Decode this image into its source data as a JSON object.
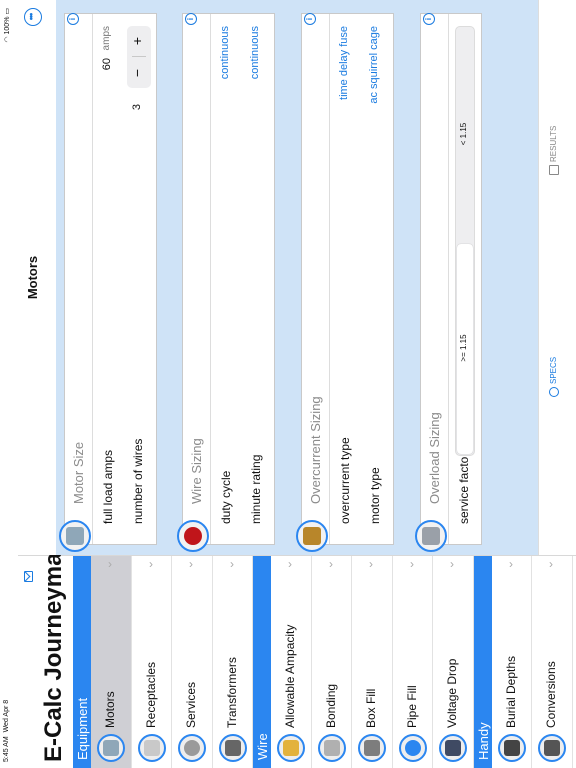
{
  "status": {
    "time": "5:45 AM",
    "date": "Wed Apr 8",
    "battery": "100%"
  },
  "app": {
    "title": "E-Calc Journeyman"
  },
  "sidebar": {
    "sections": [
      {
        "header": "Equipment",
        "items": [
          {
            "label": "Motors",
            "icon": "motor-icon",
            "selected": true
          },
          {
            "label": "Receptacles",
            "icon": "receptacle-icon"
          },
          {
            "label": "Services",
            "icon": "meter-icon"
          },
          {
            "label": "Transformers",
            "icon": "transformer-icon"
          }
        ]
      },
      {
        "header": "Wire",
        "items": [
          {
            "label": "Allowable Ampacity",
            "icon": "wire-icon"
          },
          {
            "label": "Bonding",
            "icon": "bonding-icon"
          },
          {
            "label": "Box Fill",
            "icon": "box-icon"
          },
          {
            "label": "Pipe Fill",
            "icon": "pipe-icon"
          },
          {
            "label": "Voltage Drop",
            "icon": "voltmeter-icon"
          }
        ]
      },
      {
        "header": "Handy",
        "items": [
          {
            "label": "Burial Depths",
            "icon": "shovel-icon"
          },
          {
            "label": "Conversions",
            "icon": "calculator-icon"
          }
        ]
      }
    ]
  },
  "main": {
    "title": "Motors",
    "cards": {
      "motor_size": {
        "title": "Motor Size",
        "full_load_amps_label": "full load amps",
        "full_load_amps_value": "60",
        "full_load_amps_unit": "amps",
        "number_of_wires_label": "number of wires",
        "number_of_wires_value": "3",
        "minus": "−",
        "plus": "+"
      },
      "wire_sizing": {
        "title": "Wire Sizing",
        "duty_cycle_label": "duty cycle",
        "duty_cycle_value": "continuous",
        "minute_rating_label": "minute rating",
        "minute_rating_value": "continuous"
      },
      "overcurrent_sizing": {
        "title": "Overcurrent Sizing",
        "overcurrent_type_label": "overcurrent type",
        "overcurrent_type_value": "time delay fuse",
        "motor_type_label": "motor type",
        "motor_type_value": "ac squirrel cage"
      },
      "overload_sizing": {
        "title": "Overload Sizing",
        "service_factor_label": "service factor",
        "option_1": ">= 1.15",
        "option_2": "< 1.15"
      }
    }
  },
  "tabbar": {
    "specs": "SPECS",
    "results": "RESULTS"
  },
  "colors": {
    "accent": "#2b86f0",
    "background": "#cfe3f7"
  }
}
